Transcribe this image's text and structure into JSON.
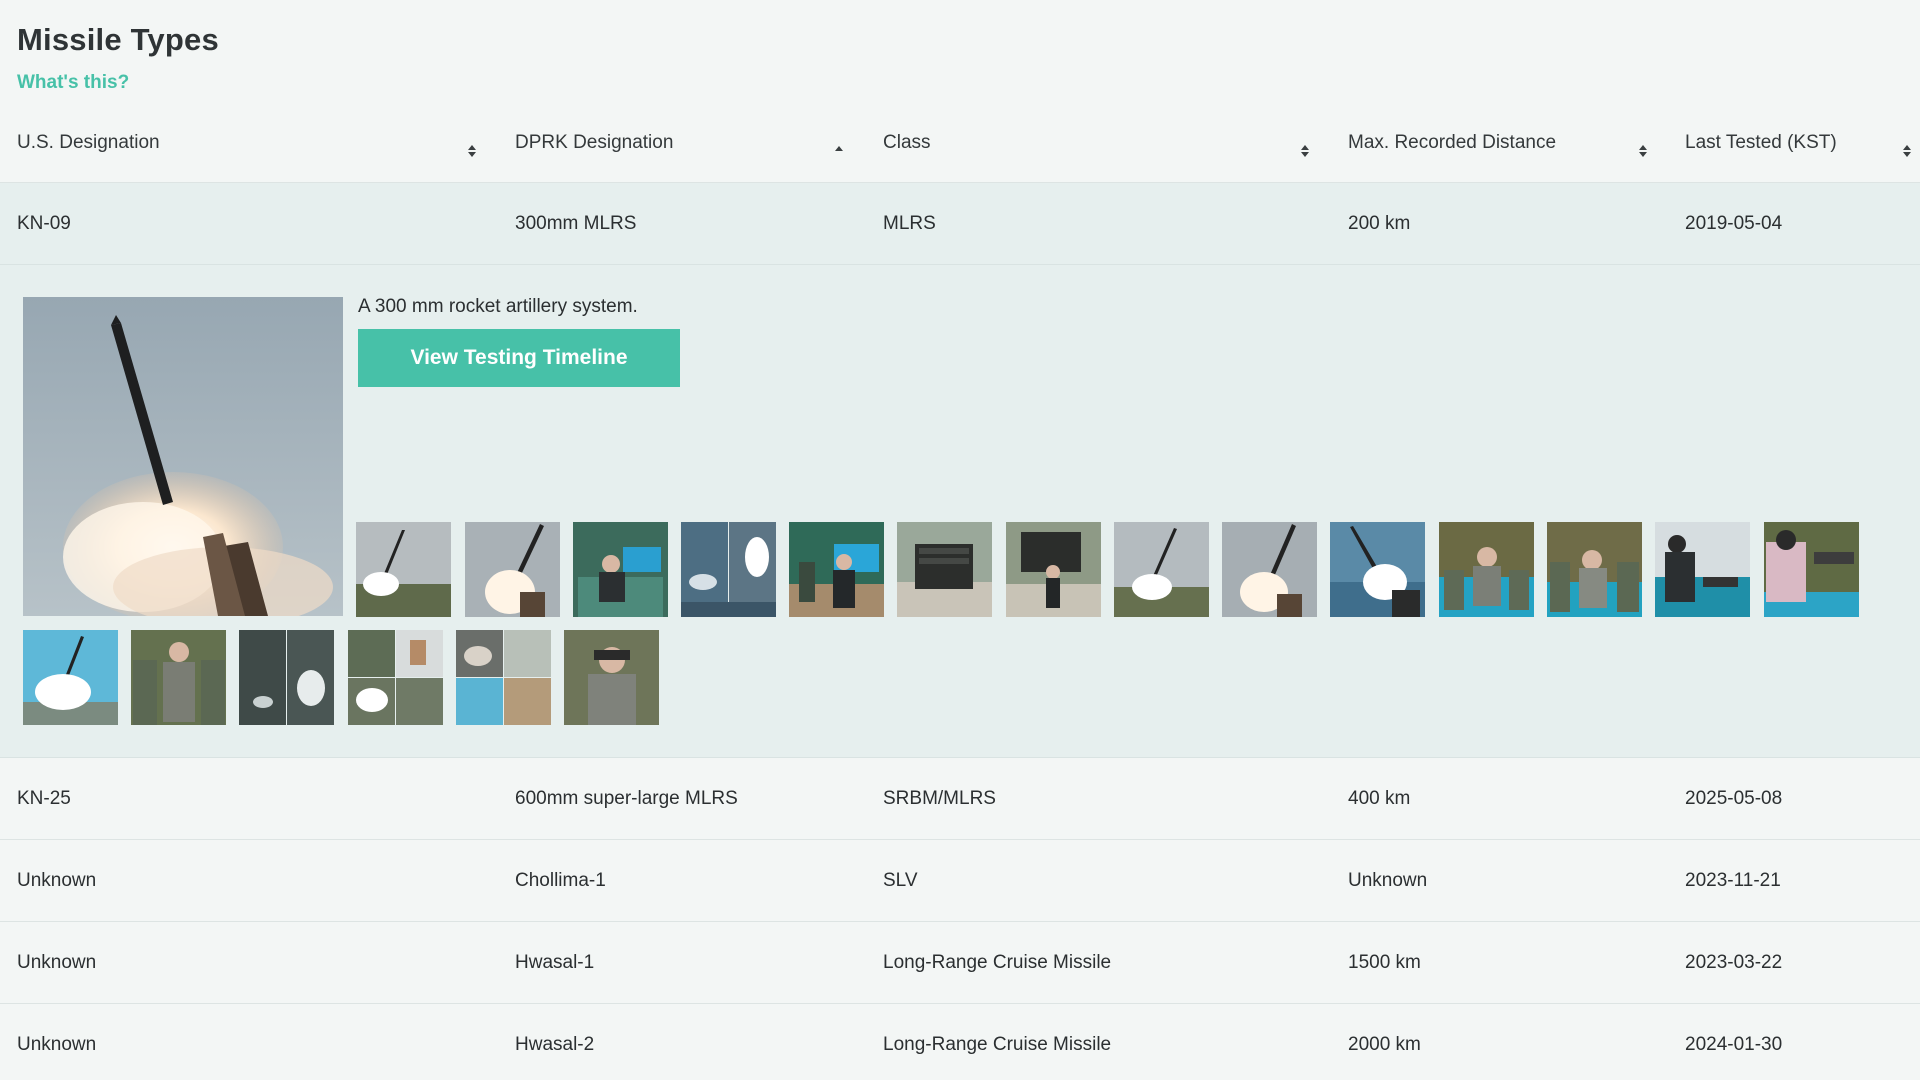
{
  "page": {
    "title": "Missile Types",
    "help_link": "What's this?"
  },
  "colors": {
    "accent": "#47c1a8",
    "page_bg": "#f3f6f5",
    "expanded_bg": "#e6efee",
    "text": "#2b2f31"
  },
  "table": {
    "columns": [
      {
        "label": "U.S. Designation",
        "sort": "none"
      },
      {
        "label": "DPRK Designation",
        "sort": "ascending"
      },
      {
        "label": "Class",
        "sort": "none"
      },
      {
        "label": "Max. Recorded Distance",
        "sort": "none"
      },
      {
        "label": "Last Tested (KST)",
        "sort": "none"
      }
    ],
    "rows": [
      {
        "us": "KN-09",
        "dprk": "300mm MLRS",
        "class": "MLRS",
        "distance": "200 km",
        "tested": "2019-05-04",
        "expanded": true
      },
      {
        "us": "KN-25",
        "dprk": "600mm super-large MLRS",
        "class": "SRBM/MLRS",
        "distance": "400 km",
        "tested": "2025-05-08"
      },
      {
        "us": "Unknown",
        "dprk": "Chollima-1",
        "class": "SLV",
        "distance": "Unknown",
        "tested": "2023-11-21"
      },
      {
        "us": "Unknown",
        "dprk": "Hwasal-1",
        "class": "Long-Range Cruise Missile",
        "distance": "1500 km",
        "tested": "2023-03-22"
      },
      {
        "us": "Unknown",
        "dprk": "Hwasal-2",
        "class": "Long-Range Cruise Missile",
        "distance": "2000 km",
        "tested": "2024-01-30"
      }
    ]
  },
  "detail": {
    "description": "A 300 mm rocket artillery system.",
    "button_label": "View Testing Timeline",
    "thumbnail_count": 20
  },
  "icons": {
    "sort_both": "sort-both-icon",
    "sort_ascending": "sort-ascending-icon"
  }
}
